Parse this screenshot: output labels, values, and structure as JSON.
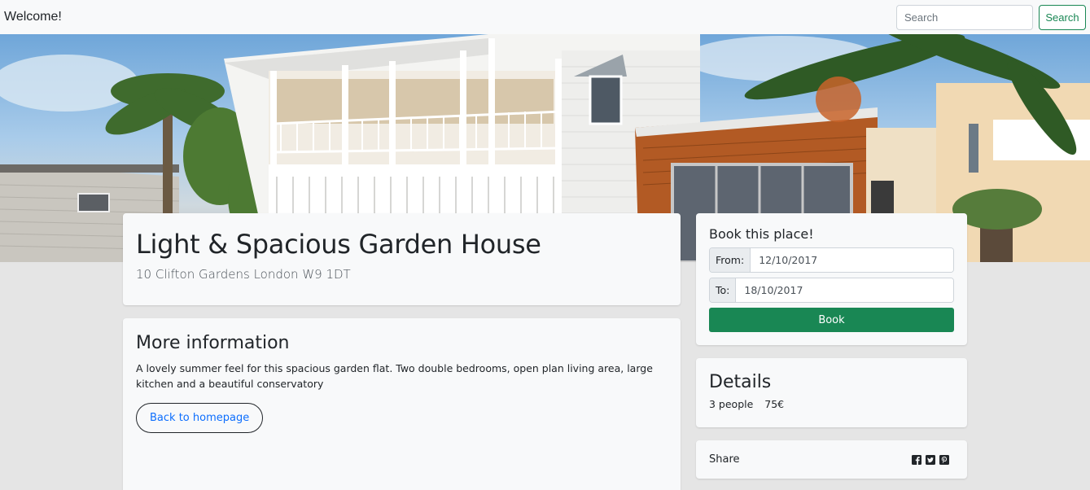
{
  "navbar": {
    "brand": "Welcome!",
    "search_placeholder": "Search",
    "search_button": "Search"
  },
  "hero": {
    "image": "house-photo"
  },
  "listing": {
    "title": "Light & Spacious Garden House",
    "address": "10 Clifton Gardens London W9 1DT"
  },
  "more_info": {
    "heading": "More information",
    "description": "A lovely summer feel for this spacious garden flat. Two double bedrooms, open plan living area, large kitchen and a beautiful conservatory",
    "back_button": "Back to homepage"
  },
  "booking": {
    "heading": "Book this place!",
    "from_label": "From:",
    "from_value": "12/10/2017",
    "to_label": "To:",
    "to_value": "18/10/2017",
    "book_button": "Book"
  },
  "details": {
    "heading": "Details",
    "people": "3 people",
    "price": "75€"
  },
  "share": {
    "label": "Share",
    "icons": [
      "facebook-icon",
      "twitter-icon",
      "pinterest-icon"
    ]
  },
  "colors": {
    "primary_green": "#198754",
    "link_blue": "#0d6efd",
    "card_bg": "#f8f9fa",
    "page_bg": "#e5e5e5"
  }
}
